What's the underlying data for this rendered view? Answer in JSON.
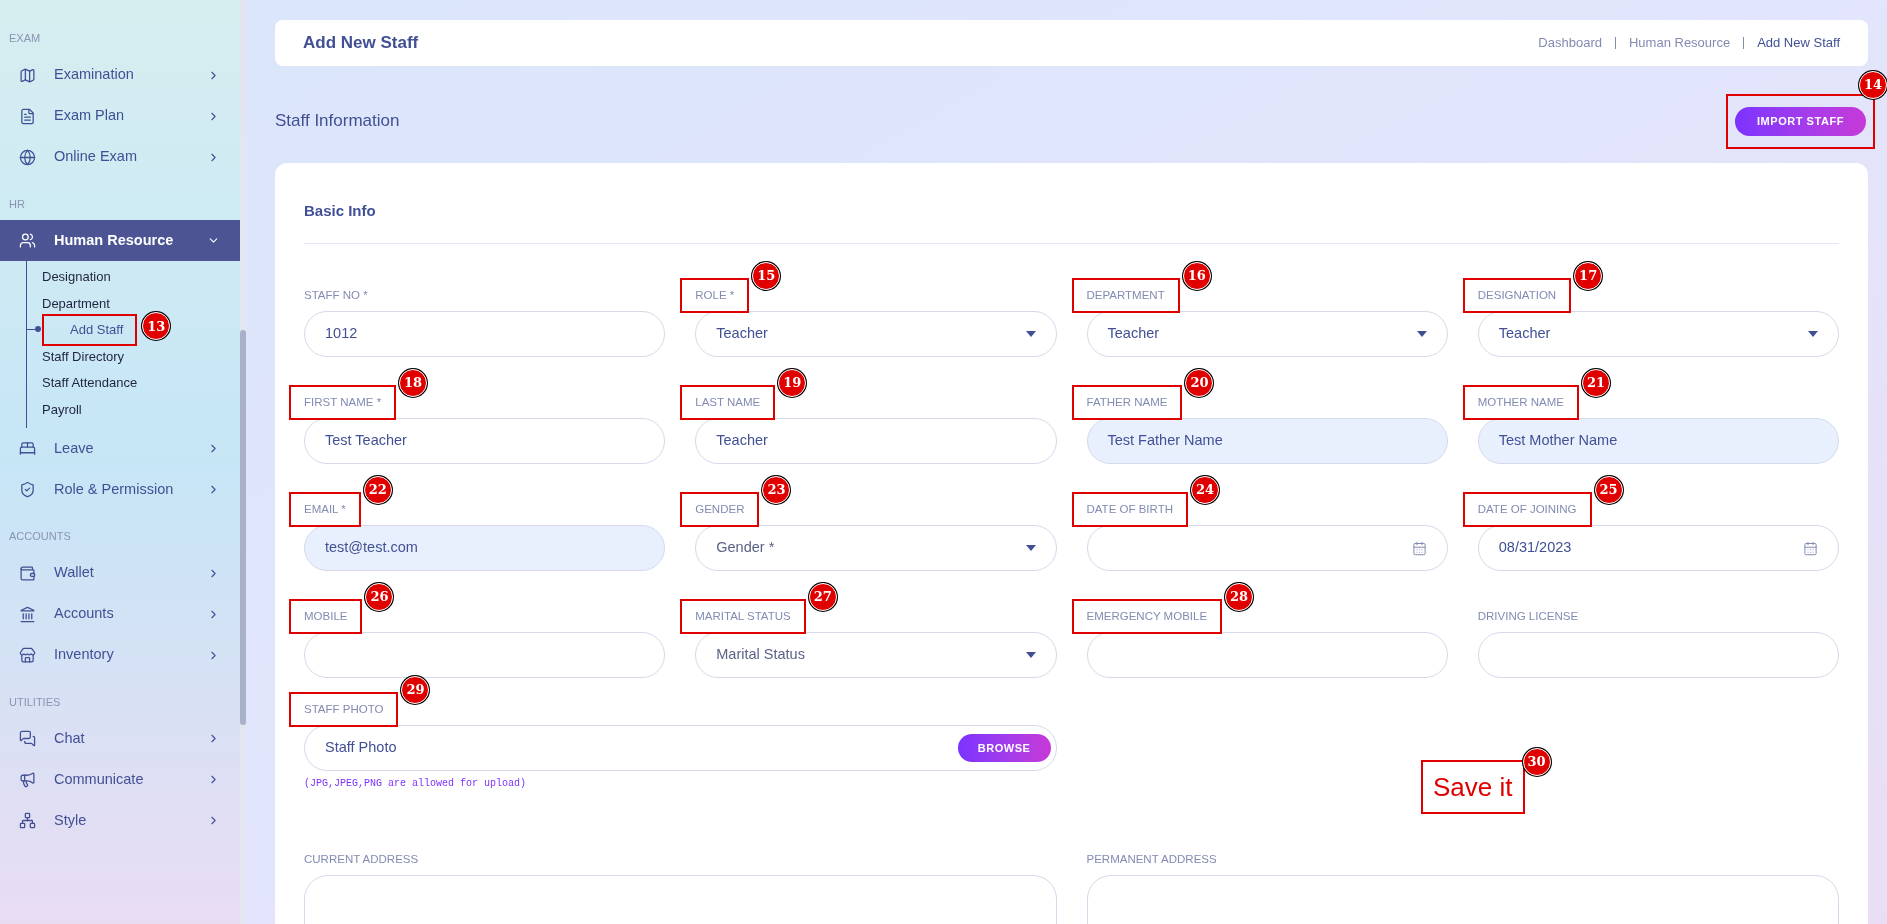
{
  "sidebar": {
    "sections": [
      {
        "heading": "EXAM",
        "items": [
          {
            "label": "Examination",
            "expanded": false,
            "selected": false
          },
          {
            "label": "Exam Plan",
            "expanded": false,
            "selected": false
          },
          {
            "label": "Online Exam",
            "expanded": false,
            "selected": false
          }
        ]
      },
      {
        "heading": "HR",
        "items": [
          {
            "label": "Human Resource",
            "expanded": true,
            "selected": true,
            "children": [
              {
                "label": "Designation",
                "selected": false
              },
              {
                "label": "Department",
                "selected": false
              },
              {
                "label": "Add Staff",
                "selected": true,
                "callout": "13"
              },
              {
                "label": "Staff Directory",
                "selected": false
              },
              {
                "label": "Staff Attendance",
                "selected": false
              },
              {
                "label": "Payroll",
                "selected": false
              }
            ]
          },
          {
            "label": "Leave",
            "expanded": false,
            "selected": false
          },
          {
            "label": "Role & Permission",
            "expanded": false,
            "selected": false
          }
        ]
      },
      {
        "heading": "ACCOUNTS",
        "items": [
          {
            "label": "Wallet",
            "expanded": false,
            "selected": false
          },
          {
            "label": "Accounts",
            "expanded": false,
            "selected": false
          },
          {
            "label": "Inventory",
            "expanded": false,
            "selected": false
          }
        ]
      },
      {
        "heading": "UTILITIES",
        "items": [
          {
            "label": "Chat",
            "expanded": false,
            "selected": false
          },
          {
            "label": "Communicate",
            "expanded": false,
            "selected": false
          },
          {
            "label": "Style",
            "expanded": false,
            "selected": false
          }
        ]
      }
    ]
  },
  "header": {
    "title": "Add New Staff",
    "breadcrumbs": [
      {
        "label": "Dashboard",
        "current": false
      },
      {
        "label": "Human Resource",
        "current": false
      },
      {
        "label": "Add New Staff",
        "current": true
      }
    ]
  },
  "section_title": "Staff Information",
  "import_button": {
    "label": "IMPORT STAFF",
    "callout": "14"
  },
  "form": {
    "title": "Basic Info",
    "fields": [
      {
        "kind": "text",
        "label": "STAFF NO *",
        "value": "1012",
        "autofilled": false
      },
      {
        "kind": "select",
        "label": "ROLE *",
        "value": "Teacher",
        "callout": "15"
      },
      {
        "kind": "select",
        "label": "DEPARTMENT",
        "value": "Teacher",
        "callout": "16"
      },
      {
        "kind": "select",
        "label": "DESIGNATION",
        "value": "Teacher",
        "callout": "17"
      },
      {
        "kind": "text",
        "label": "FIRST NAME *",
        "value": "Test Teacher",
        "autofilled": false,
        "callout": "18"
      },
      {
        "kind": "text",
        "label": "LAST NAME",
        "value": "Teacher",
        "autofilled": false,
        "callout": "19"
      },
      {
        "kind": "text",
        "label": "FATHER NAME",
        "value": "Test Father Name",
        "autofilled": true,
        "callout": "20"
      },
      {
        "kind": "text",
        "label": "MOTHER NAME",
        "value": "Test Mother Name",
        "autofilled": true,
        "callout": "21"
      },
      {
        "kind": "text",
        "label": "EMAIL *",
        "value": "test@test.com",
        "autofilled": true,
        "callout": "22"
      },
      {
        "kind": "select",
        "label": "GENDER",
        "placeholder": "Gender *",
        "callout": "23"
      },
      {
        "kind": "date",
        "label": "DATE OF BIRTH",
        "callout": "24"
      },
      {
        "kind": "date",
        "label": "DATE OF JOINING",
        "value": "08/31/2023",
        "callout": "25"
      },
      {
        "kind": "text",
        "label": "MOBILE",
        "autofilled": false,
        "callout": "26"
      },
      {
        "kind": "select",
        "label": "MARITAL STATUS",
        "placeholder": "Marital Status",
        "callout": "27"
      },
      {
        "kind": "text",
        "label": "EMERGENCY MOBILE",
        "autofilled": false,
        "callout": "28"
      },
      {
        "kind": "text",
        "label": "DRIVING LICENSE",
        "autofilled": false
      },
      {
        "kind": "file",
        "label": "STAFF PHOTO",
        "placeholder": "Staff Photo",
        "button": "BROWSE",
        "hint": "(JPG,JPEG,PNG are allowed for upload)",
        "callout": "29"
      },
      {
        "kind": "note",
        "text": "Save it",
        "callout": "30"
      },
      {
        "kind": "textarea",
        "label": "CURRENT ADDRESS"
      },
      {
        "kind": "textarea",
        "label": "PERMANENT ADDRESS"
      }
    ]
  }
}
